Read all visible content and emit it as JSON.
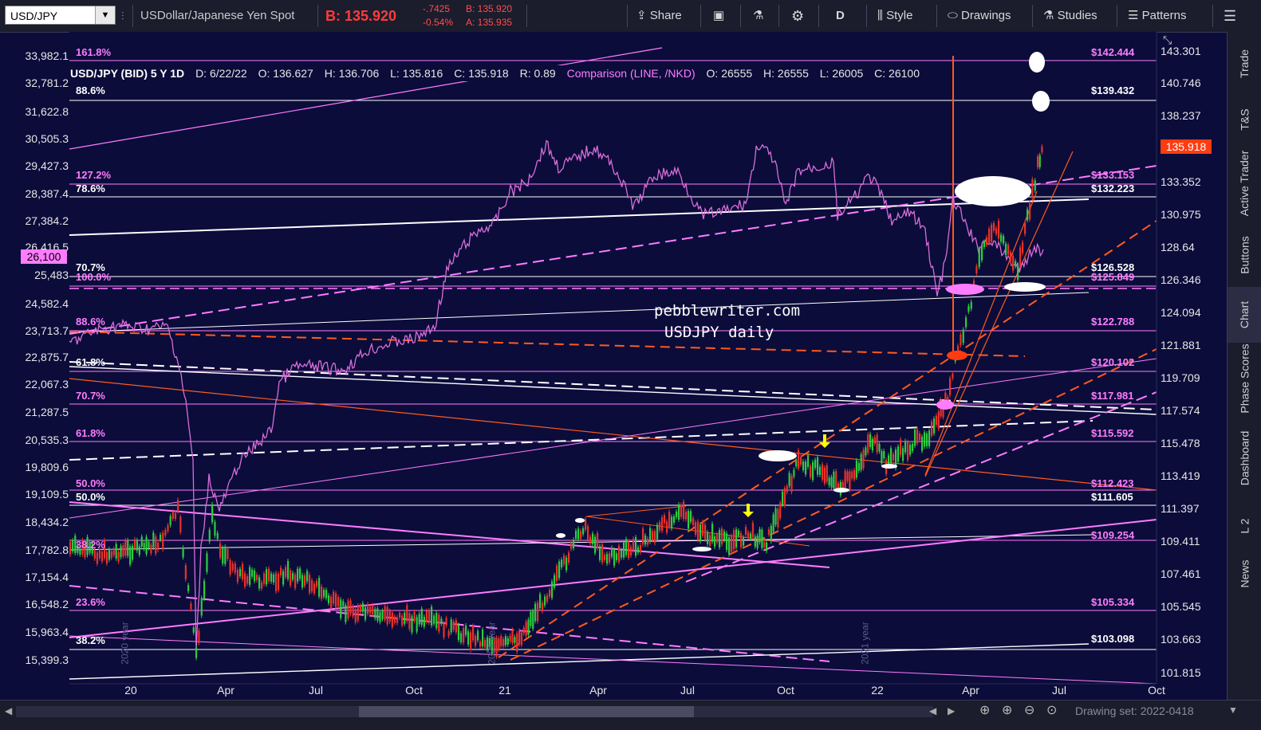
{
  "toolbar": {
    "symbol": "USD/JPY",
    "description": "USDollar/Japanese Yen Spot",
    "bid_price": "B: 135.920",
    "change": "-.7425",
    "change_pct": "-0.54%",
    "bid_small": "B: 135.920",
    "ask_small": "A: 135.935",
    "share": "Share",
    "period": "D",
    "style": "Style",
    "drawings": "Drawings",
    "studies": "Studies",
    "patterns": "Patterns"
  },
  "legend": {
    "title": "USD/JPY (BID) 5 Y 1D",
    "date": "D: 6/22/22",
    "open": "O: 136.627",
    "high": "H: 136.706",
    "low": "L: 135.816",
    "close": "C: 135.918",
    "range": "R: 0.89",
    "comparison": "Comparison (LINE, /NKD)",
    "cmp_open": "O: 26555",
    "cmp_high": "H: 26555",
    "cmp_low": "L: 26005",
    "cmp_close": "C: 26100"
  },
  "left_axis": [
    "33,982.1",
    "32,781.2",
    "31,622.8",
    "30,505.3",
    "29,427.3",
    "28,387.4",
    "27,384.2",
    "26,416.5",
    "25,483",
    "24,582.4",
    "23,713.7",
    "22,875.7",
    "22,067.3",
    "21,287.5",
    "20,535.3",
    "19,809.6",
    "19,109.5",
    "18,434.2",
    "17,782.8",
    "17,154.4",
    "16,548.2",
    "15,963.4",
    "15,399.3"
  ],
  "left_current": "26,100",
  "right_axis": [
    "143.301",
    "140.746",
    "138.237",
    "135.918",
    "133.352",
    "130.975",
    "128.64",
    "126.346",
    "124.094",
    "121.881",
    "119.709",
    "117.574",
    "115.478",
    "113.419",
    "111.397",
    "109.411",
    "107.461",
    "105.545",
    "103.663",
    "101.815"
  ],
  "right_current": "135.918",
  "x_axis": [
    "20",
    "Apr",
    "Jul",
    "Oct",
    "21",
    "Apr",
    "Jul",
    "Oct",
    "22",
    "Apr",
    "Jul",
    "Oct"
  ],
  "fib_labels": [
    {
      "text": "161.8%",
      "color": "#ff7cff"
    },
    {
      "text": "88.6%",
      "color": "#ffffff"
    },
    {
      "text": "127.2%",
      "color": "#ff7cff"
    },
    {
      "text": "78.6%",
      "color": "#ffffff"
    },
    {
      "text": "70.7%",
      "color": "#ffffff"
    },
    {
      "text": "100.0%",
      "color": "#ff7cff"
    },
    {
      "text": "88.6%",
      "color": "#ff7cff"
    },
    {
      "text": "61.8%",
      "color": "#ffffff"
    },
    {
      "text": "70.7%",
      "color": "#ff7cff"
    },
    {
      "text": "61.8%",
      "color": "#ff7cff"
    },
    {
      "text": "50.0%",
      "color": "#ff7cff"
    },
    {
      "text": "50.0%",
      "color": "#ffffff"
    },
    {
      "text": "38.2%",
      "color": "#ff7cff"
    },
    {
      "text": "23.6%",
      "color": "#ff7cff"
    },
    {
      "text": "38.2%",
      "color": "#ffffff"
    }
  ],
  "levels": [
    {
      "text": "$142.444",
      "color": "#ff7cff"
    },
    {
      "text": "$139.432",
      "color": "#ffffff"
    },
    {
      "text": "$133.153",
      "color": "#ff7cff"
    },
    {
      "text": "$132.223",
      "color": "#ffffff"
    },
    {
      "text": "$126.528",
      "color": "#ffffff"
    },
    {
      "text": "$125.849",
      "color": "#ff7cff"
    },
    {
      "text": "$122.788",
      "color": "#ff7cff"
    },
    {
      "text": "$120.102",
      "color": "#ff7cff"
    },
    {
      "text": "$117.981",
      "color": "#ff7cff"
    },
    {
      "text": "$115.592",
      "color": "#ff7cff"
    },
    {
      "text": "$112.423",
      "color": "#ff7cff"
    },
    {
      "text": "$111.605",
      "color": "#ffffff"
    },
    {
      "text": "$109.254",
      "color": "#ff7cff"
    },
    {
      "text": "$105.334",
      "color": "#ff7cff"
    },
    {
      "text": "$103.098",
      "color": "#ffffff"
    }
  ],
  "watermark": {
    "line1": "pebblewriter.com",
    "line2": "USDJPY daily"
  },
  "year_marks": [
    "2020 year",
    "2021 year",
    "2021 year"
  ],
  "side_tabs": [
    "Trade",
    "T&S",
    "Active Trader",
    "Buttons",
    "Chart",
    "Phase Scores",
    "Dashboard",
    "L 2",
    "News"
  ],
  "drawing_set": "Drawing set: 2022-0418",
  "colors": {
    "bg": "#0b0c3a",
    "magenta": "#ff7cff",
    "orange": "#ff5a1f",
    "white": "#ffffff",
    "up": "#2ecc40",
    "down": "#e8322b"
  }
}
